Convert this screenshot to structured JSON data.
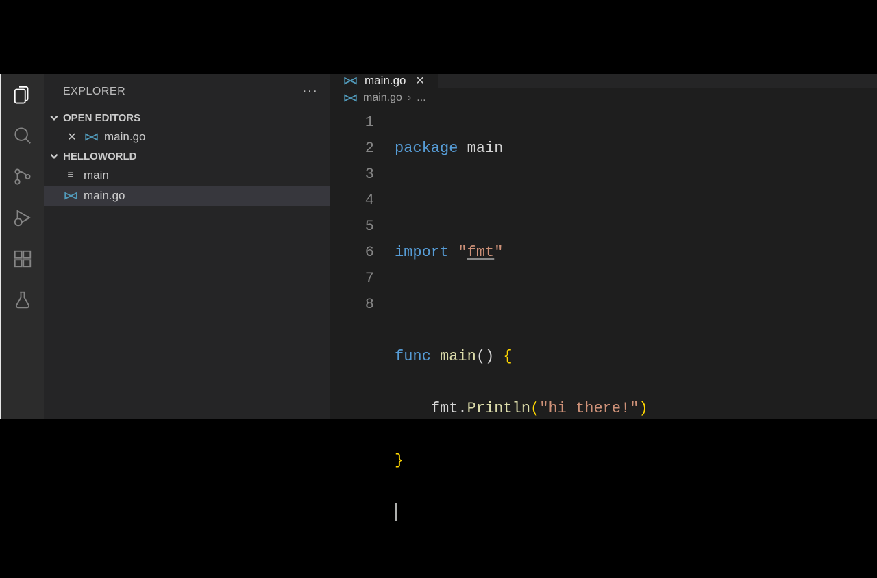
{
  "sidebar": {
    "title": "EXPLORER",
    "sections": {
      "openEditors": {
        "label": "OPEN EDITORS",
        "items": [
          {
            "filename": "main.go"
          }
        ]
      },
      "workspace": {
        "label": "HELLOWORLD",
        "items": [
          {
            "filename": "main",
            "type": "generic"
          },
          {
            "filename": "main.go",
            "type": "go",
            "selected": true
          }
        ]
      }
    }
  },
  "editor": {
    "tab": {
      "filename": "main.go"
    },
    "breadcrumb": {
      "filename": "main.go",
      "rest": "..."
    },
    "code": {
      "lines": [
        "1",
        "2",
        "3",
        "4",
        "5",
        "6",
        "7",
        "8"
      ],
      "l1_kw": "package",
      "l1_name": " main",
      "l3_kw": "import",
      "l3_q1": " \"",
      "l3_pkg": "fmt",
      "l3_q2": "\"",
      "l5_kw": "func",
      "l5_fn": " main",
      "l5_paren": "()",
      "l5_brace": " {",
      "l6_indent": "    ",
      "l6_obj": "fmt",
      "l6_dot": ".",
      "l6_call": "Println",
      "l6_open": "(",
      "l6_str": "\"hi there!\"",
      "l6_close": ")",
      "l7_brace": "}"
    }
  }
}
